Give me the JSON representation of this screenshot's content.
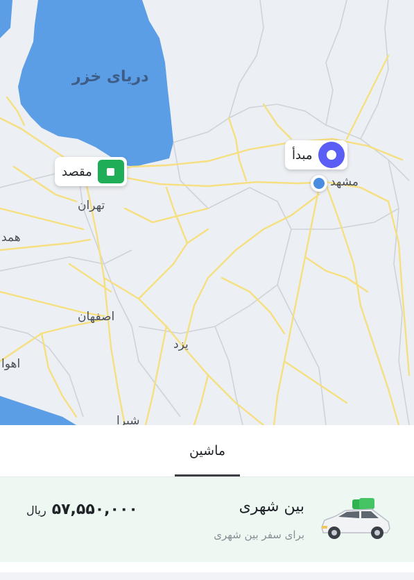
{
  "map": {
    "sea_label": "دریای خزر",
    "city_labels": [
      "تهران",
      "همد",
      "اصفهان",
      "یزد",
      "اهوا",
      "شیرا",
      "مشهد"
    ],
    "destination_marker": {
      "label": "مقصد",
      "color": "#1fae57"
    },
    "origin_marker": {
      "label": "مبدأ",
      "color": "#5a5ef5"
    },
    "colors": {
      "land": "#eceff3",
      "water": "#5c9ee6",
      "roads": "#f7df7a",
      "borders": "#d3d6db"
    }
  },
  "tabs": [
    {
      "label": "ماشین",
      "selected": true
    }
  ],
  "service": {
    "title": "بین شهری",
    "subtitle": "برای سفر بین شهری",
    "price": "۵۷,۵۵۰,۰۰۰",
    "currency": "ریال",
    "icon": "car-with-luggage-icon",
    "background": "#edf8f3"
  }
}
